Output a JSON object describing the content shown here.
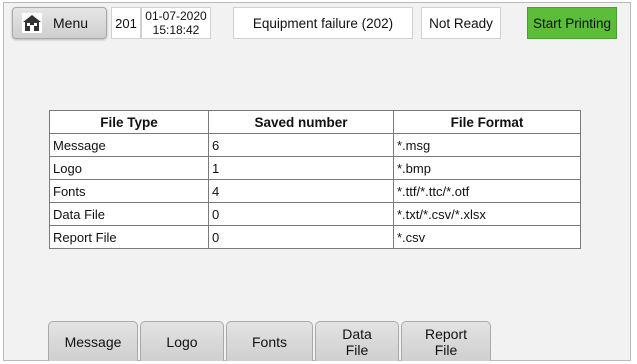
{
  "header": {
    "menu_label": "Menu",
    "menu_icon": "home-icon",
    "job_id": "201",
    "date": "01-07-2020",
    "time": "15:18:42",
    "status": "Equipment failure (202)",
    "readiness": "Not Ready",
    "print_button": "Start Printing",
    "print_button_color": "#5bbd3a"
  },
  "table": {
    "columns": [
      "File Type",
      "Saved number",
      "File Format"
    ],
    "rows": [
      [
        "Message",
        "6",
        "*.msg"
      ],
      [
        "Logo",
        "1",
        "*.bmp"
      ],
      [
        "Fonts",
        "4",
        "*.ttf/*.ttc/*.otf"
      ],
      [
        "Data File",
        "0",
        "*.txt/*.csv/*.xlsx"
      ],
      [
        "Report File",
        "0",
        "*.csv"
      ]
    ]
  },
  "tabs": [
    "Message",
    "Logo",
    "Fonts",
    "Data\nFile",
    "Report\nFile"
  ]
}
